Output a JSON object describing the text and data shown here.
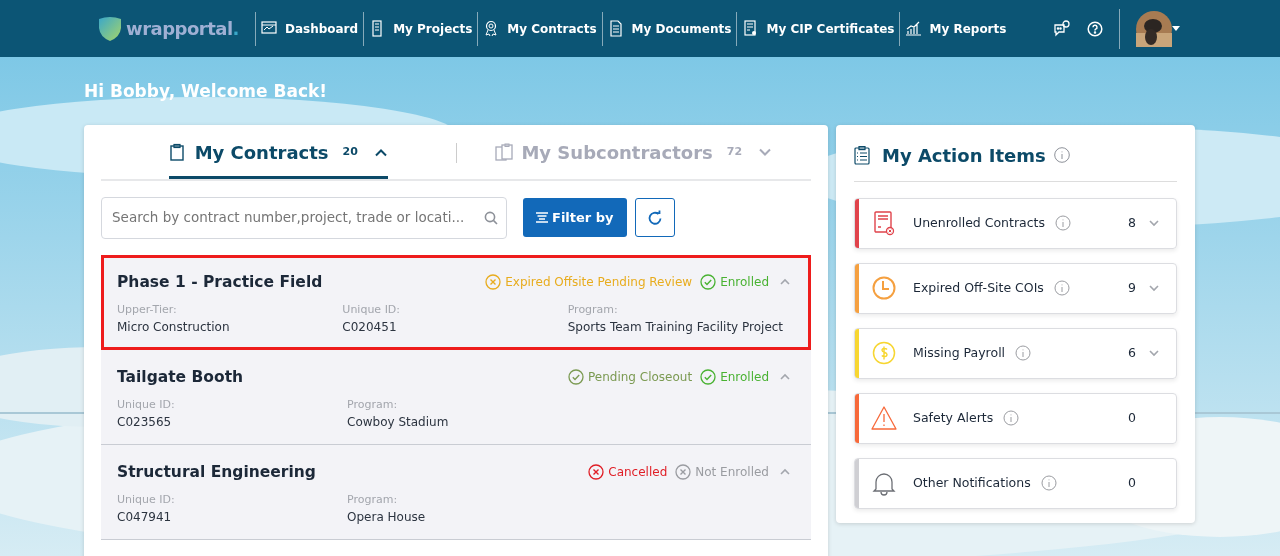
{
  "nav": {
    "logo": "wrapportal",
    "logo_dot": ".",
    "items": [
      {
        "label": "Dashboard",
        "kind": "dashboard"
      },
      {
        "label": "My Projects",
        "kind": "projects"
      },
      {
        "label": "My Contracts",
        "kind": "contracts"
      },
      {
        "label": "My Documents",
        "kind": "documents"
      },
      {
        "label": "My CIP Certificates",
        "kind": "certificates"
      },
      {
        "label": "My Reports",
        "kind": "reports"
      }
    ]
  },
  "greeting": "Hi Bobby, Welcome Back!",
  "contracts_panel": {
    "tabs": [
      {
        "label": "My Contracts",
        "count": "20",
        "selected": true,
        "expanded": true
      },
      {
        "label": "My Subcontractors",
        "count": "72",
        "selected": false,
        "expanded": false
      }
    ],
    "search": {
      "placeholder": "Search by contract number,project, trade or locati..."
    },
    "filter_button": "Filter by",
    "contracts": [
      {
        "title": "Phase 1 - Practice Field",
        "highlighted": true,
        "statuses": [
          {
            "label": "Expired Offsite Pending Review",
            "kind": "expired"
          },
          {
            "label": "Enrolled",
            "kind": "enrolled"
          }
        ],
        "fields": [
          {
            "label": "Upper-Tier:",
            "value": "Micro Construction"
          },
          {
            "label": "Unique ID:",
            "value": "C020451"
          },
          {
            "label": "Program:",
            "value": "Sports Team Training Facility Project"
          }
        ]
      },
      {
        "title": "Tailgate Booth",
        "highlighted": false,
        "statuses": [
          {
            "label": "Pending Closeout",
            "kind": "pending"
          },
          {
            "label": "Enrolled",
            "kind": "enrolled"
          }
        ],
        "fields": [
          {
            "label": "Unique ID:",
            "value": "C023565"
          },
          {
            "label": "Program:",
            "value": "Cowboy Stadium"
          }
        ]
      },
      {
        "title": "Structural Engineering",
        "highlighted": false,
        "statuses": [
          {
            "label": "Cancelled",
            "kind": "cancelled"
          },
          {
            "label": "Not Enrolled",
            "kind": "not-enrolled"
          }
        ],
        "fields": [
          {
            "label": "Unique ID:",
            "value": "C047941"
          },
          {
            "label": "Program:",
            "value": "Opera House"
          }
        ]
      }
    ]
  },
  "action_items": {
    "title": "My Action Items",
    "items": [
      {
        "label": "Unenrolled Contracts",
        "count": "8",
        "color": "#e0434b",
        "kind": "unenrolled",
        "expandable": true
      },
      {
        "label": "Expired Off-Site COIs",
        "count": "9",
        "color": "#f5a040",
        "kind": "expired",
        "expandable": true
      },
      {
        "label": "Missing Payroll",
        "count": "6",
        "color": "#f7d631",
        "kind": "payroll",
        "expandable": true
      },
      {
        "label": "Safety Alerts",
        "count": "0",
        "color": "#f7693a",
        "kind": "safety",
        "expandable": false
      },
      {
        "label": "Other Notifications",
        "count": "0",
        "color": "#cfcfd3",
        "kind": "notifications",
        "expandable": false
      }
    ]
  }
}
